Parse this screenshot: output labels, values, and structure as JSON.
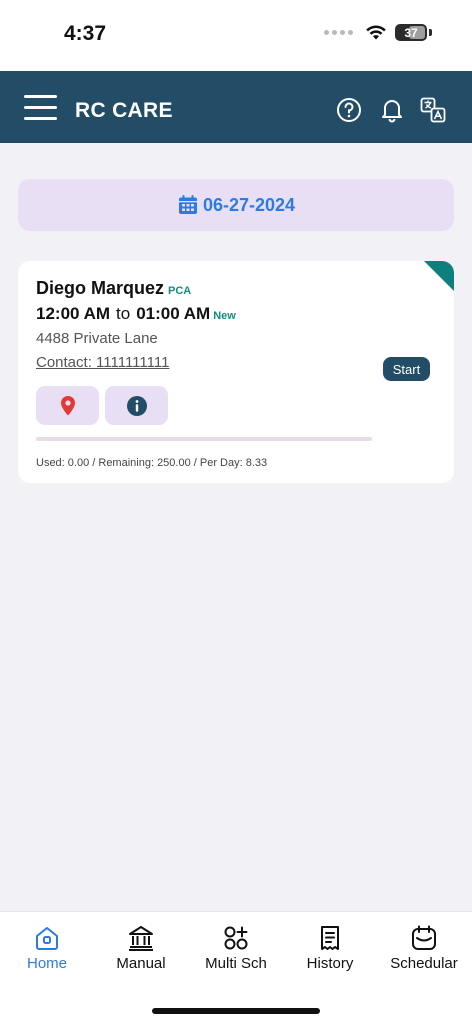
{
  "status_bar": {
    "time": "4:37",
    "battery": "37"
  },
  "header": {
    "title": "RC CARE",
    "icons": [
      "menu-icon",
      "help-icon",
      "bell-icon",
      "translate-icon"
    ]
  },
  "date_bar": {
    "date": "06-27-2024",
    "icon": "calendar-icon"
  },
  "schedule": {
    "client_name": "Diego Marquez",
    "service": "PCA",
    "start_time": "12:00 AM",
    "time_separator": "to",
    "end_time": "01:00 AM",
    "status": "New",
    "address": "4488 Private Lane",
    "contact": "Contact: 1111111111",
    "start_label": "Start",
    "usage": "Used: 0.00 / Remaining: 250.00 / Per Day: 8.33",
    "used_fraction": 0.0
  },
  "bottom_nav": {
    "items": [
      {
        "label": "Home",
        "icon": "home-icon",
        "active": true
      },
      {
        "label": "Manual",
        "icon": "bank-icon",
        "active": false
      },
      {
        "label": "Multi Sch",
        "icon": "grid-plus-icon",
        "active": false
      },
      {
        "label": "History",
        "icon": "receipt-icon",
        "active": false
      },
      {
        "label": "Schedular",
        "icon": "calendar-box-icon",
        "active": false
      }
    ]
  },
  "colors": {
    "header_bg": "#234d66",
    "accent_blue": "#2c7be5",
    "teal": "#0f7f7e",
    "lavender": "#e8dff5",
    "location_red": "#e53935"
  }
}
